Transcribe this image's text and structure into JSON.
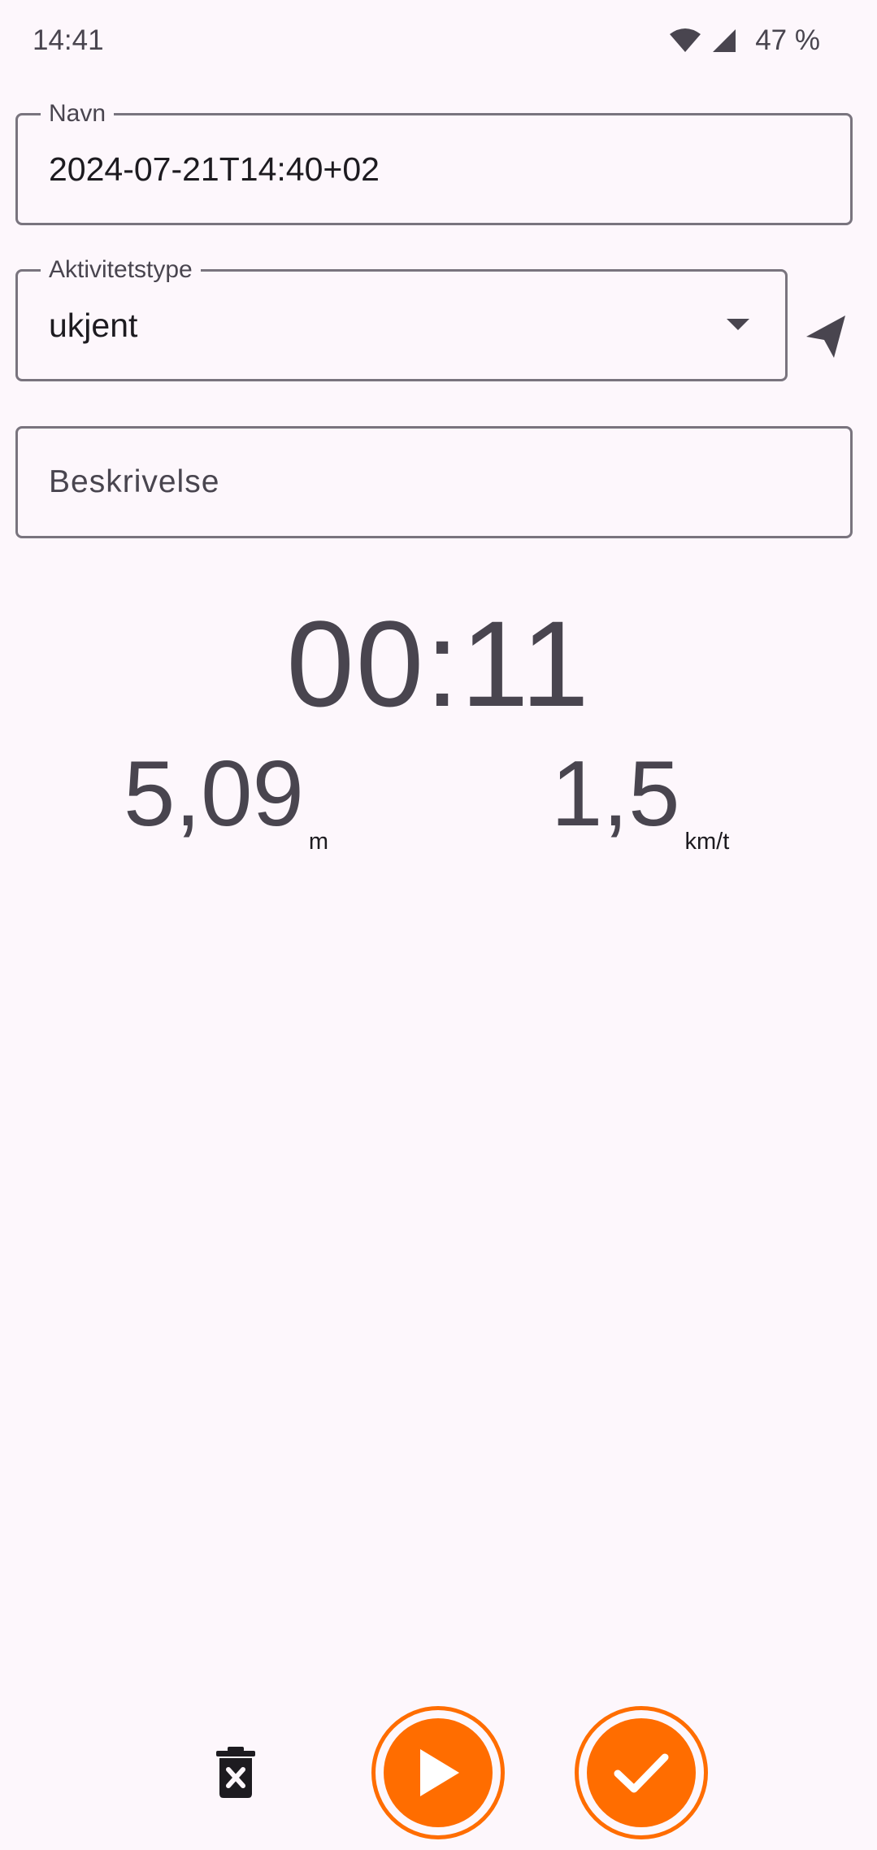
{
  "status_bar": {
    "time": "14:41",
    "battery": "47 %",
    "icons": [
      "wifi-icon",
      "signal-icon"
    ]
  },
  "form": {
    "name": {
      "label": "Navn",
      "value": "2024-07-21T14:40+02"
    },
    "activity_type": {
      "label": "Aktivitetstype",
      "value": "ukjent"
    },
    "description": {
      "placeholder": "Beskrivelse"
    }
  },
  "stats": {
    "elapsed": "00:11",
    "distance": {
      "value": "5,09",
      "unit": "m"
    },
    "speed": {
      "value": "1,5",
      "unit": "km/t"
    }
  },
  "controls": {
    "icons": [
      "delete-icon",
      "play-icon",
      "check-icon",
      "navigation-arrow-icon"
    ]
  },
  "colors": {
    "background": "#fdf7fc",
    "accent": "#ff6d00",
    "outline": "#79747e",
    "text_secondary": "#49454f"
  }
}
